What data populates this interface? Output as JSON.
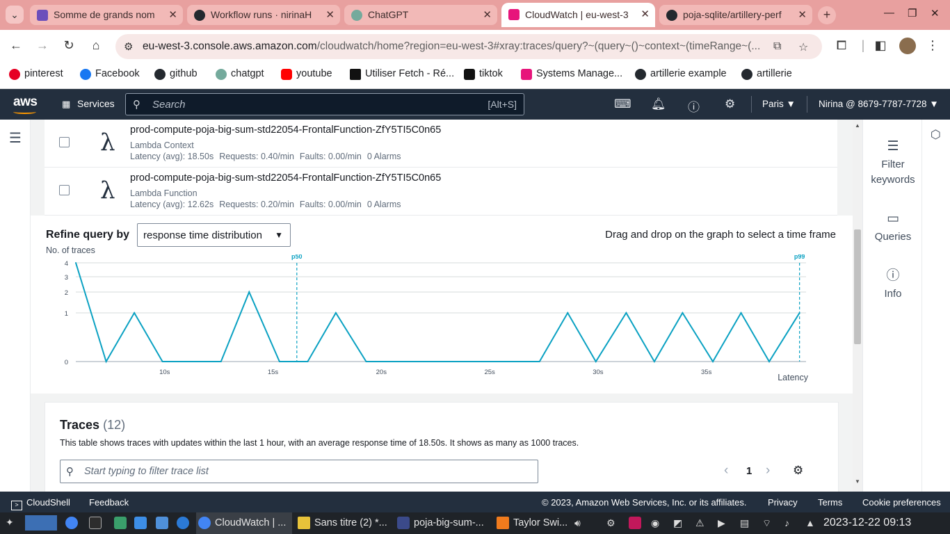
{
  "browser": {
    "tabs": [
      {
        "title": "Somme de grands nom",
        "color": "#6b4fbb"
      },
      {
        "title": "Workflow runs · nirinaH",
        "color": "#24292f"
      },
      {
        "title": "ChatGPT",
        "color": "#74aa9c"
      },
      {
        "title": "CloudWatch | eu-west-3",
        "color": "#e7157b"
      },
      {
        "title": "poja-sqlite/artillery-perf",
        "color": "#24292f"
      }
    ],
    "url_domain": "eu-west-3.console.aws.amazon.com",
    "url_path": "/cloudwatch/home?region=eu-west-3#xray:traces/query?~(query~()~context~(timeRange~(...",
    "bookmarks": [
      {
        "label": "pinterest",
        "color": "#e60023"
      },
      {
        "label": "Facebook",
        "color": "#1877f2"
      },
      {
        "label": "github",
        "color": "#24292f"
      },
      {
        "label": "chatgpt",
        "color": "#74aa9c"
      },
      {
        "label": "youtube",
        "color": "#ff0000"
      },
      {
        "label": "Utiliser Fetch - Ré...",
        "color": "#111111"
      },
      {
        "label": "tiktok",
        "color": "#111111"
      },
      {
        "label": "Systems Manage...",
        "color": "#e7157b"
      },
      {
        "label": "artillerie example",
        "color": "#24292f"
      },
      {
        "label": "artillerie",
        "color": "#24292f"
      }
    ]
  },
  "aws": {
    "logo": "aws",
    "services_label": "Services",
    "search_placeholder": "Search",
    "search_shortcut": "[Alt+S]",
    "region": "Paris",
    "account": "Nirina @ 8679-7787-7728"
  },
  "nodes": [
    {
      "name": "prod-compute-poja-big-sum-std22054-FrontalFunction-ZfY5TI5C0n65",
      "type": "Lambda Context",
      "latency": "Latency (avg): 18.50s",
      "requests": "Requests: 0.40/min",
      "faults": "Faults: 0.00/min",
      "alarms": "0 Alarms"
    },
    {
      "name": "prod-compute-poja-big-sum-std22054-FrontalFunction-ZfY5TI5C0n65",
      "type": "Lambda Function",
      "latency": "Latency (avg): 12.62s",
      "requests": "Requests: 0.20/min",
      "faults": "Faults: 0.00/min",
      "alarms": "0 Alarms"
    }
  ],
  "refine": {
    "label": "Refine query by",
    "selected": "response time distribution",
    "hint": "Drag and drop on the graph to select a time frame"
  },
  "chart_data": {
    "type": "line",
    "ylabel": "No. of traces",
    "xlabel": "Latency",
    "y_ticks": [
      "4",
      "3",
      "2",
      "1",
      "0"
    ],
    "x_ticks": [
      "10s",
      "15s",
      "20s",
      "25s",
      "30s",
      "35s"
    ],
    "x_tick_values": [
      10,
      15,
      20,
      25,
      30,
      35
    ],
    "xlim": [
      5.9,
      39.6
    ],
    "x": [
      5.9,
      7.3,
      8.6,
      9.9,
      11.3,
      12.6,
      13.9,
      15.3,
      16.6,
      17.9,
      19.3,
      20.6,
      21.9,
      23.3,
      24.6,
      25.9,
      27.3,
      28.6,
      29.9,
      31.3,
      32.6,
      33.9,
      35.3,
      36.6,
      37.9,
      39.3
    ],
    "y": [
      4,
      0,
      1,
      0,
      0,
      0,
      2,
      0,
      0,
      1,
      0,
      0,
      0,
      0,
      0,
      0,
      0,
      1,
      0,
      1,
      0,
      1,
      0,
      1,
      0,
      1
    ],
    "annotations": [
      {
        "label": "p50",
        "x": 16.1
      },
      {
        "label": "p99",
        "x": 39.3
      }
    ],
    "color": "#0aa1c2"
  },
  "traces": {
    "title": "Traces",
    "count": "(12)",
    "description": "This table shows traces with updates within the last 1 hour, with an average response time of 18.50s. It shows as many as 1000 traces.",
    "filter_placeholder": "Start typing to filter trace list",
    "page": "1"
  },
  "right_panel": {
    "filter_keywords": "Filter keywords",
    "queries": "Queries",
    "info": "Info"
  },
  "footer": {
    "cloudshell": "CloudShell",
    "feedback": "Feedback",
    "copyright": "© 2023, Amazon Web Services, Inc. or its affiliates.",
    "privacy": "Privacy",
    "terms": "Terms",
    "cookies": "Cookie preferences"
  },
  "taskbar": {
    "apps": [
      {
        "label": "CloudWatch | ...",
        "color": "#4285f4"
      },
      {
        "label": "Sans titre (2) *...",
        "color": "#e8c33a"
      },
      {
        "label": "poja-big-sum-...",
        "color": "#3b4a8a"
      },
      {
        "label": "Taylor Swi...",
        "color": "#f07b1d"
      }
    ],
    "clock": "2023-12-22  09:13"
  }
}
